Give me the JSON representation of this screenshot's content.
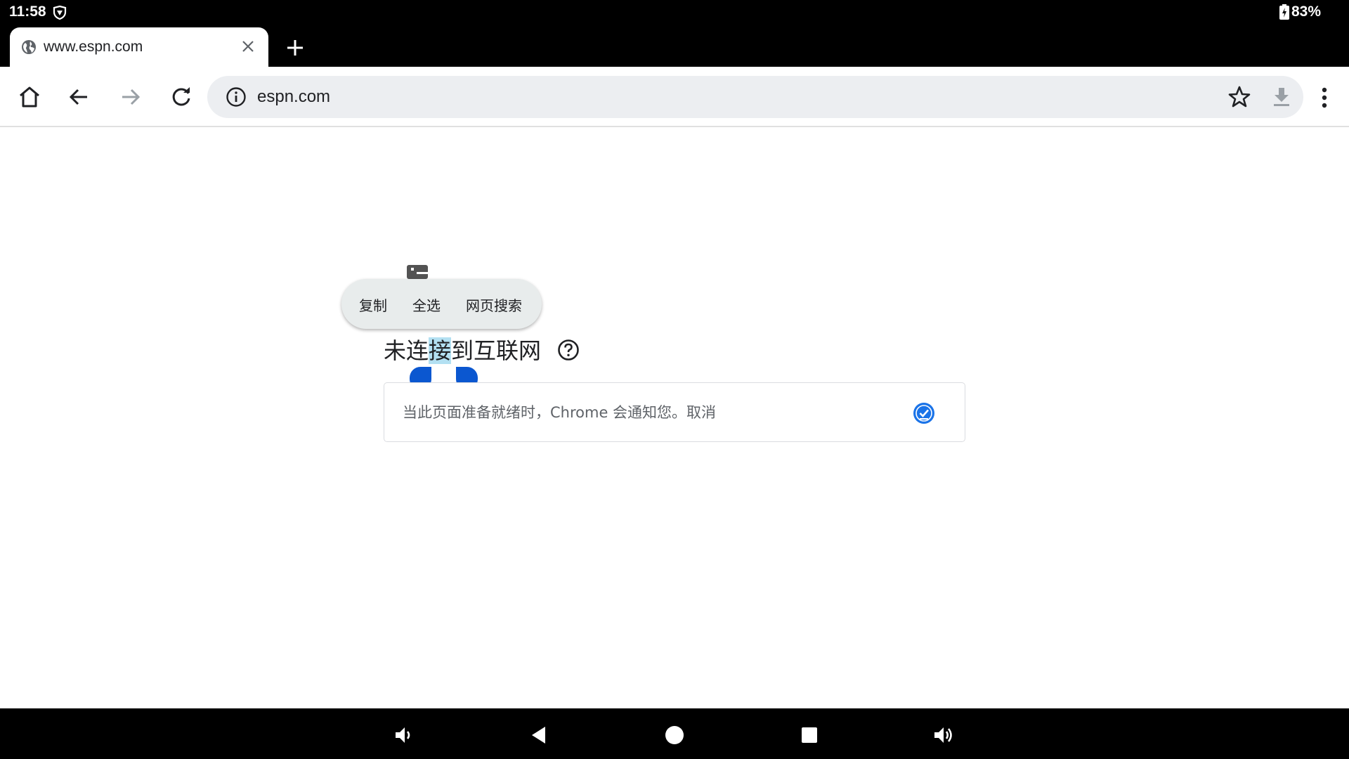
{
  "status": {
    "time": "11:58",
    "battery": "83%"
  },
  "tab": {
    "title": "www.espn.com"
  },
  "omnibox": {
    "url": "espn.com"
  },
  "context_menu": {
    "copy": "复制",
    "select_all": "全选",
    "web_search": "网页搜索"
  },
  "error": {
    "heading_before": "未连",
    "heading_selected": "接",
    "heading_after": "到互联网",
    "notify_text": "当此页面准备就绪时，Chrome 会通知您。取消"
  },
  "colors": {
    "accent": "#1a73e8",
    "selection_handle": "#0b57d0",
    "selection": "#b3e0f2"
  },
  "icons": [
    "vpn-key-icon",
    "battery-icon",
    "globe-icon",
    "close-icon",
    "plus-icon",
    "home-icon",
    "back-arrow-icon",
    "forward-arrow-icon",
    "reload-icon",
    "info-icon",
    "star-icon",
    "download-icon",
    "more-vert-icon",
    "dino-icon",
    "help-icon",
    "check-circle-icon",
    "volume-down-icon",
    "nav-back-icon",
    "nav-home-icon",
    "nav-recents-icon",
    "volume-up-icon"
  ]
}
